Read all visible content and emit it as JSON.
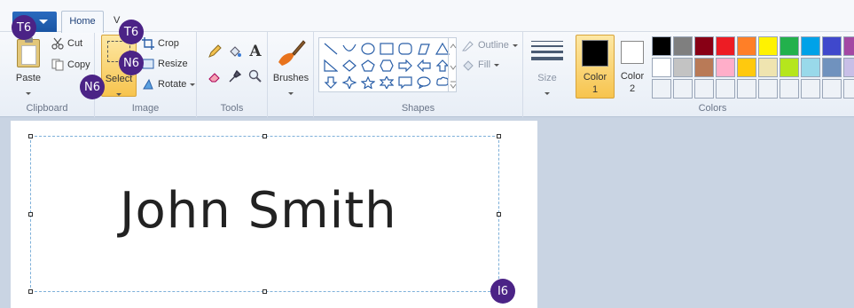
{
  "tabs": {
    "home": "Home",
    "view": "V"
  },
  "clipboard": {
    "paste": "Paste",
    "cut": "Cut",
    "copy": "Copy",
    "label": "Clipboard"
  },
  "image": {
    "select": "Select",
    "crop": "Crop",
    "resize": "Resize",
    "rotate": "Rotate",
    "label": "Image"
  },
  "tools": {
    "label": "Tools",
    "text_tool": "A"
  },
  "brushes": {
    "label": "Brushes"
  },
  "shapes": {
    "label": "Shapes",
    "outline": "Outline",
    "fill": "Fill"
  },
  "size": {
    "label": "Size"
  },
  "colors": {
    "color1_label": "Color",
    "color1_num": "1",
    "color2_label": "Color",
    "color2_num": "2",
    "label": "Colors",
    "color1": "#000000",
    "color2": "#ffffff",
    "palette": [
      "#000000",
      "#7f7f7f",
      "#880015",
      "#ed1c24",
      "#ff7f27",
      "#fff200",
      "#22b14c",
      "#00a2e8",
      "#3f48cc",
      "#a349a4",
      "#ffffff",
      "#c3c3c3",
      "#b97a57",
      "#ffaec9",
      "#ffc90e",
      "#efe4b0",
      "#b5e61d",
      "#99d9ea",
      "#7092be",
      "#c8bfe7",
      "#eef2f7",
      "#eef2f7",
      "#eef2f7",
      "#eef2f7",
      "#eef2f7",
      "#eef2f7",
      "#eef2f7",
      "#eef2f7",
      "#eef2f7",
      "#eef2f7"
    ]
  },
  "canvas": {
    "text": "John Smith"
  },
  "badges": {
    "b1": "T6",
    "b2": "T6",
    "b3": "N6",
    "b4": "N6",
    "b5": "I6"
  }
}
